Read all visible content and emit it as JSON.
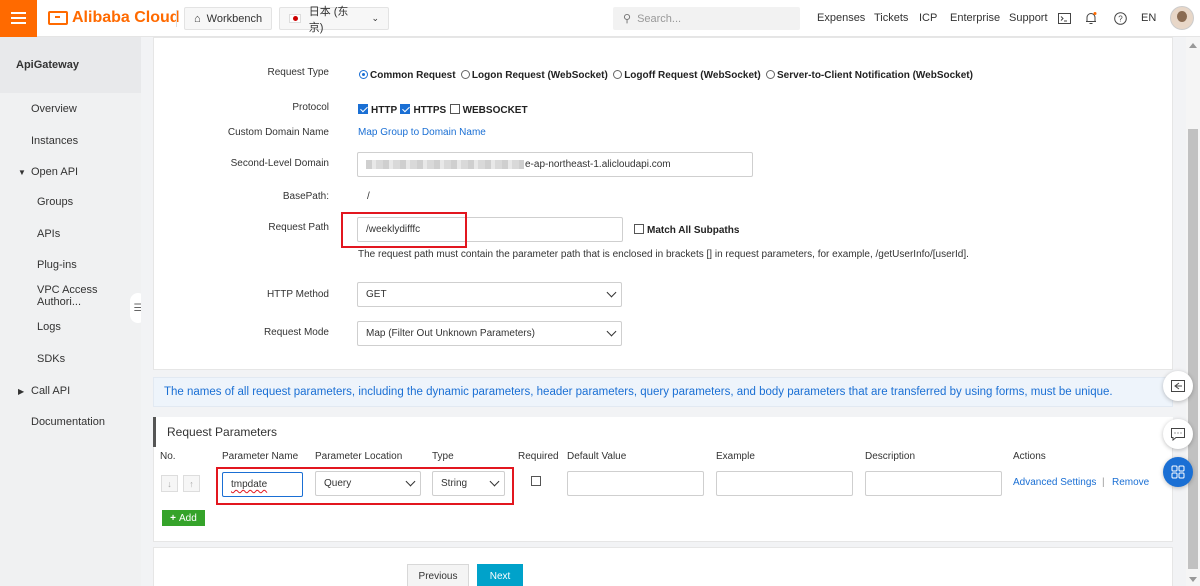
{
  "topbar": {
    "brand": "Alibaba Cloud",
    "workbench": "Workbench",
    "region": "日本 (东京)",
    "search_placeholder": "Search...",
    "links": [
      "Expenses",
      "Tickets",
      "ICP",
      "Enterprise",
      "Support"
    ],
    "lang": "EN"
  },
  "sidebar": {
    "title": "ApiGateway",
    "items": [
      {
        "label": "Overview"
      },
      {
        "label": "Instances"
      },
      {
        "label": "Open API"
      },
      {
        "label": "Groups"
      },
      {
        "label": "APIs"
      },
      {
        "label": "Plug-ins"
      },
      {
        "label": "VPC Access Authori..."
      },
      {
        "label": "Logs"
      },
      {
        "label": "SDKs"
      },
      {
        "label": "Call API"
      },
      {
        "label": "Documentation"
      }
    ]
  },
  "form": {
    "request_type_label": "Request Type",
    "request_type_options": [
      "Common Request",
      "Logon Request (WebSocket)",
      "Logoff Request (WebSocket)",
      "Server-to-Client Notification (WebSocket)"
    ],
    "protocol_label": "Protocol",
    "protocols": [
      "HTTP",
      "HTTPS",
      "WEBSOCKET"
    ],
    "custom_domain_label": "Custom Domain Name",
    "custom_domain_link": "Map Group to Domain Name",
    "second_level_label": "Second-Level Domain",
    "second_level_suffix": "e-ap-northeast-1.alicloudapi.com",
    "basepath_label": "BasePath:",
    "basepath_value": "/",
    "request_path_label": "Request Path",
    "request_path_value": "/weeklydifffc",
    "match_subpaths": "Match All Subpaths",
    "request_path_hint": "The request path must contain the parameter path that is enclosed in brackets [] in request parameters, for example, /getUserInfo/[userId].",
    "http_method_label": "HTTP Method",
    "http_method_value": "GET",
    "request_mode_label": "Request Mode",
    "request_mode_value": "Map (Filter Out Unknown Parameters)"
  },
  "notice": "The names of all request parameters, including the dynamic parameters, header parameters, query parameters, and body parameters that are transferred by using forms, must be unique.",
  "params": {
    "title": "Request Parameters",
    "columns": [
      "No.",
      "Parameter Name",
      "Parameter Location",
      "Type",
      "Required",
      "Default Value",
      "Example",
      "Description",
      "Actions"
    ],
    "row": {
      "name": "tmpdate",
      "location": "Query",
      "type": "String",
      "advanced": "Advanced Settings",
      "separator": "|",
      "remove": "Remove"
    },
    "add_label": "Add"
  },
  "footer": {
    "previous": "Previous",
    "next": "Next"
  },
  "colors": {
    "accent": "#ff6a00",
    "link": "#1a6fd4",
    "highlight": "#e2161f",
    "add": "#35a32a"
  }
}
